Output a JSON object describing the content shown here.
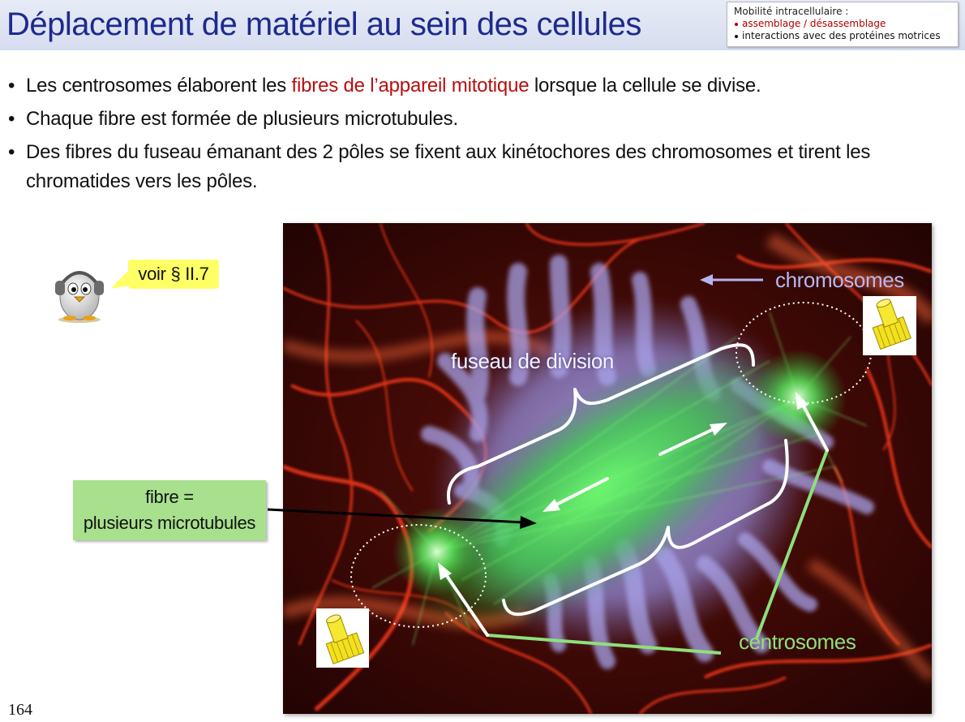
{
  "slide": {
    "title": "Déplacement de matériel au sein des cellules",
    "page_number": "164"
  },
  "corner_box": {
    "heading": "Mobilité intracellulaire :",
    "items": [
      "assemblage / désassemblage",
      "interactions avec des protéines motrices"
    ],
    "item_colors": [
      "#b00000",
      "#111111"
    ]
  },
  "bullets": [
    {
      "before": "Les centrosomes élaborent les ",
      "highlight": "fibres de l’appareil mitotique",
      "after": " lorsque la cellule se divise."
    },
    {
      "before": "Chaque fibre est formée de plusieurs microtubules.",
      "highlight": "",
      "after": ""
    },
    {
      "before": "Des fibres du fuseau émanant des 2 pôles se fixent aux kinétochores des chromosomes et tirent les chromatides vers les pôles.",
      "highlight": "",
      "after": ""
    }
  ],
  "callout": {
    "text": "voir § II.7",
    "icon": "penguin-headphones-icon"
  },
  "fibre_box": {
    "line1": "fibre =",
    "line2": "plusieurs microtubules"
  },
  "figure_labels": {
    "chromosomes": "chromosomes",
    "spindle": "fuseau de division",
    "centrosomes": "centrosomes"
  },
  "colors": {
    "title": "#1e2a8c",
    "highlight": "#b80f0f",
    "callout_bg": "#ffff66",
    "fibre_box_bg": "#a8e08e",
    "chromosomes_label": "#b9b7ef",
    "centrosomes_label": "#8fe07a"
  }
}
